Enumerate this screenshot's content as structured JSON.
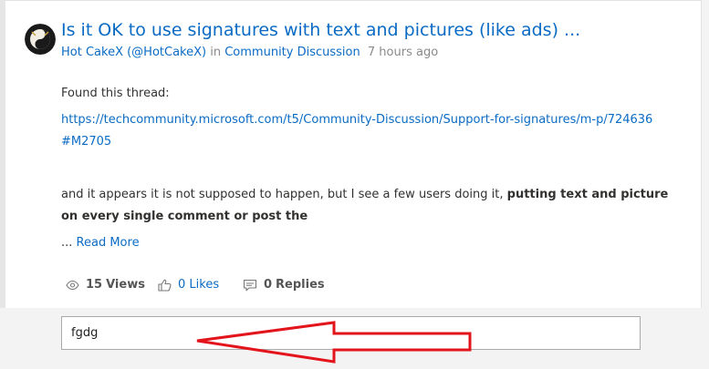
{
  "post": {
    "title": "Is it OK to use signatures with text and pictures (like ads) ...",
    "author": "Hot CakeX (@HotCakeX)",
    "in_label": "in",
    "board": "Community Discussion",
    "time": "7 hours ago",
    "body_intro": "Found this thread:",
    "link_line1": "https://techcommunity.microsoft.com/t5/Community-Discussion/Support-for-signatures/m-p/724636",
    "link_line2": "#M2705",
    "body_line1_plain": "and it appears it is not supposed to happen, but I see a few users doing it,",
    "body_line1_bold": "putting text and picture",
    "body_line2_bold": "on every single comment or post the",
    "ellipsis": "...",
    "read_more": "Read More"
  },
  "stats": {
    "views_count": "15",
    "views_label": "Views",
    "likes_label": "0 Likes",
    "replies_count": "0",
    "replies_label": "Replies"
  },
  "reply": {
    "value": "fgdg"
  },
  "colors": {
    "link": "#0b6bc4",
    "annotation_arrow": "#e3141b"
  },
  "icons": [
    "avatar-yin-yang-icon",
    "eye-icon",
    "thumbs-up-icon",
    "comment-icon",
    "red-arrow-annotation"
  ]
}
